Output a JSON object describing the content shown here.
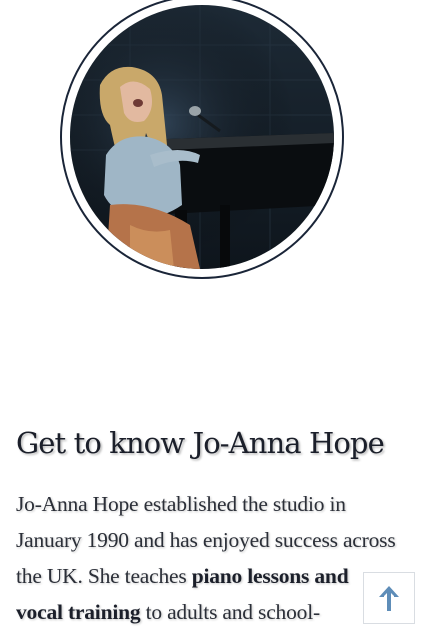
{
  "hero": {
    "photo_icon": "performer-at-piano-photo"
  },
  "about": {
    "heading": "Get to know Jo-Anna Hope",
    "paragraph_part1": "Jo-Anna Hope established the studio in January 1990 and has enjoyed success across the UK. She teaches ",
    "paragraph_bold": "piano lessons and vocal training",
    "paragraph_part2": " to adults and school-"
  },
  "back_to_top": {
    "icon": "arrow-up-icon"
  },
  "colors": {
    "ring": "#1a2538",
    "arrow": "#5e8db8",
    "text": "#1b1f2a"
  }
}
